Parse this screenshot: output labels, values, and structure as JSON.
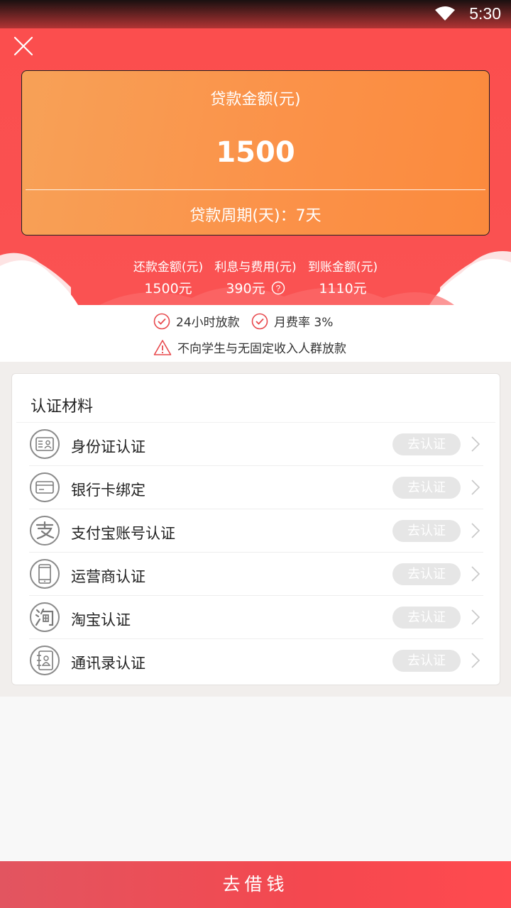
{
  "status_bar": {
    "time": "5:30"
  },
  "loan_card": {
    "amount_label": "贷款金额(元)",
    "amount": "1500",
    "period_text": "贷款周期(天)：7天"
  },
  "summary": [
    {
      "title": "还款金额(元)",
      "value": "1500元"
    },
    {
      "title": "利息与费用(元)",
      "value": "390元"
    },
    {
      "title": "到账金额(元)",
      "value": "1110元"
    }
  ],
  "features": {
    "fast_loan": "24小时放款",
    "monthly_rate": "月费率 3%",
    "warning": "不向学生与无固定收入人群放款"
  },
  "verification": {
    "title": "认证材料",
    "items": [
      {
        "label": "身份证认证",
        "action": "去认证",
        "icon": "id-card-icon"
      },
      {
        "label": "银行卡绑定",
        "action": "去认证",
        "icon": "bank-card-icon"
      },
      {
        "label": "支付宝账号认证",
        "action": "去认证",
        "icon": "alipay-icon"
      },
      {
        "label": "运营商认证",
        "action": "去认证",
        "icon": "phone-icon"
      },
      {
        "label": "淘宝认证",
        "action": "去认证",
        "icon": "taobao-icon"
      },
      {
        "label": "通讯录认证",
        "action": "去认证",
        "icon": "contacts-icon"
      }
    ]
  },
  "bottom_button": "去借钱",
  "colors": {
    "primary_red": "#fa5252",
    "card_orange": "#fb9249",
    "check_red": "#e8484c",
    "button_gray": "#e6e6e6"
  }
}
